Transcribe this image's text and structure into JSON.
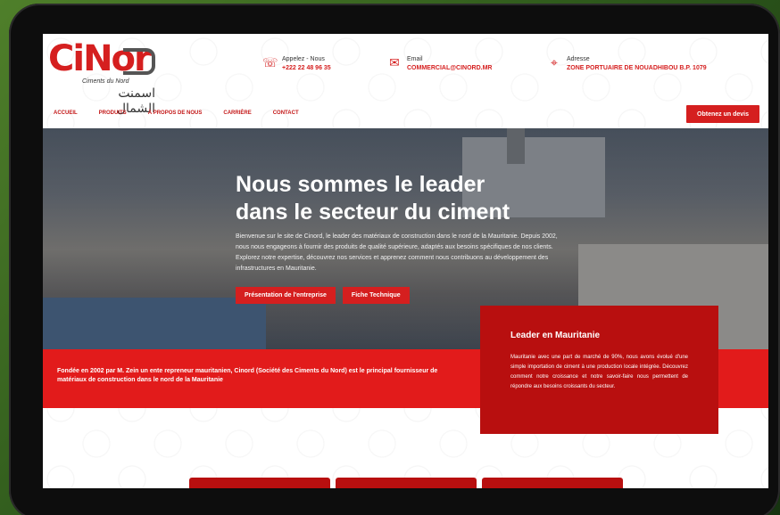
{
  "logo": {
    "name": "CiNor",
    "subtitle": "Ciments du Nord",
    "arabic": "اسمنت الشمال"
  },
  "contacts": [
    {
      "label": "Appelez - Nous",
      "value": "+222 22 48 96 35",
      "icon": "phone-icon"
    },
    {
      "label": "Email",
      "value": "COMMERCIAL@CINORD.MR",
      "icon": "mail-icon"
    },
    {
      "label": "Adresse",
      "value": "ZONE PORTUAIRE DE NOUADHIBOU B.P. 1079",
      "icon": "location-icon"
    }
  ],
  "nav": [
    "ACCUEIL",
    "PRODUITS",
    "À PROPOS DE NOUS",
    "CARRIÈRE",
    "CONTACT"
  ],
  "devis_button": "Obtenez un devis",
  "hero": {
    "title_line1": "Nous sommes le leader",
    "title_line2": "dans le secteur du ciment",
    "text": "Bienvenue sur le site de Cinord, le leader des matériaux de construction dans le nord de la Mauritanie. Depuis 2002, nous nous engageons à fournir des produits de qualité supérieure, adaptés aux besoins spécifiques de nos clients. Explorez notre expertise, découvrez nos services et apprenez comment nous contribuons au développement des infrastructures en Mauritanie.",
    "btn_presentation": "Présentation de l'entreprise",
    "btn_fiche": "Fiche Technique"
  },
  "band_text": "Fondée en 2002 par M. Zein un ente repreneur mauritanien, Cinord (Société des Ciments du Nord) est le principal fournisseur de matériaux de construction dans le nord de la Mauritanie",
  "leader": {
    "title": "Leader en Mauritanie",
    "text": "Mauritanie avec une part de marché de 90%, nous avons évolué d'une simple importation de ciment à une production locale intégrée. Découvrez comment notre croissance et notre savoir-faire nous permettent de répondre aux besoins croissants du secteur."
  },
  "colors": {
    "brand_red": "#d51f1f",
    "dark_red": "#b80f0f"
  }
}
